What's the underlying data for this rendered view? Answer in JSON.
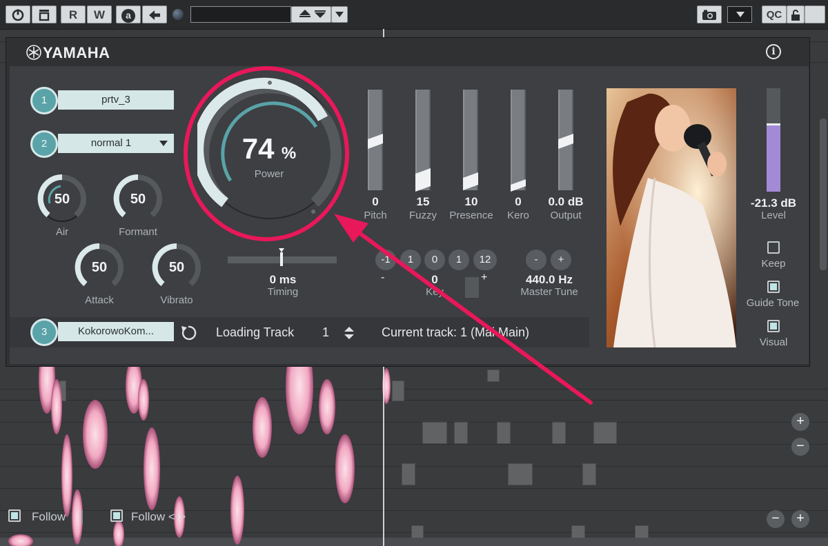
{
  "toolbar": {
    "r_label": "R",
    "w_label": "W",
    "a_label": "a",
    "qc_label": "QC"
  },
  "plugin": {
    "brand": "YAMAHA",
    "slots": [
      {
        "number": "1",
        "value": "prtv_3"
      },
      {
        "number": "2",
        "value": "normal 1"
      },
      {
        "number": "3",
        "value": "KokorowoKom..."
      }
    ],
    "knobs": {
      "air": {
        "value": "50",
        "label": "Air"
      },
      "formant": {
        "value": "50",
        "label": "Formant"
      },
      "attack": {
        "value": "50",
        "label": "Attack"
      },
      "vibrato": {
        "value": "50",
        "label": "Vibrato"
      }
    },
    "power": {
      "value": "74",
      "unit": "%",
      "label": "Power",
      "level": 0.74
    },
    "timing": {
      "value": "0 ms",
      "label": "Timing"
    },
    "faders": [
      {
        "value": "0",
        "label": "Pitch"
      },
      {
        "value": "15",
        "label": "Fuzzy"
      },
      {
        "value": "10",
        "label": "Presence"
      },
      {
        "value": "0",
        "label": "Kero"
      },
      {
        "value": "0.0 dB",
        "label": "Output"
      }
    ],
    "key": {
      "pills": [
        "-1",
        "1",
        "0",
        "1",
        "12"
      ],
      "minus": "-",
      "plus": "+",
      "value": "0",
      "label": "Key"
    },
    "master_tune": {
      "minus": "-",
      "plus": "+",
      "value": "440.0 Hz",
      "label": "Master Tune"
    },
    "level": {
      "value": "-21.3 dB",
      "label": "Level"
    },
    "toggles": [
      {
        "label": "Keep",
        "checked": false
      },
      {
        "label": "Guide Tone",
        "checked": true
      },
      {
        "label": "Visual",
        "checked": true
      }
    ],
    "loading": {
      "label": "Loading Track",
      "value": "1",
      "current": "Current track: 1 (Mai Main)"
    }
  },
  "editor": {
    "follow_label": "Follow",
    "follow_lr_label": "Follow <->"
  },
  "colors": {
    "accent": "#e8185a",
    "teal": "#5aa3a8",
    "level": "#a38ad6"
  }
}
